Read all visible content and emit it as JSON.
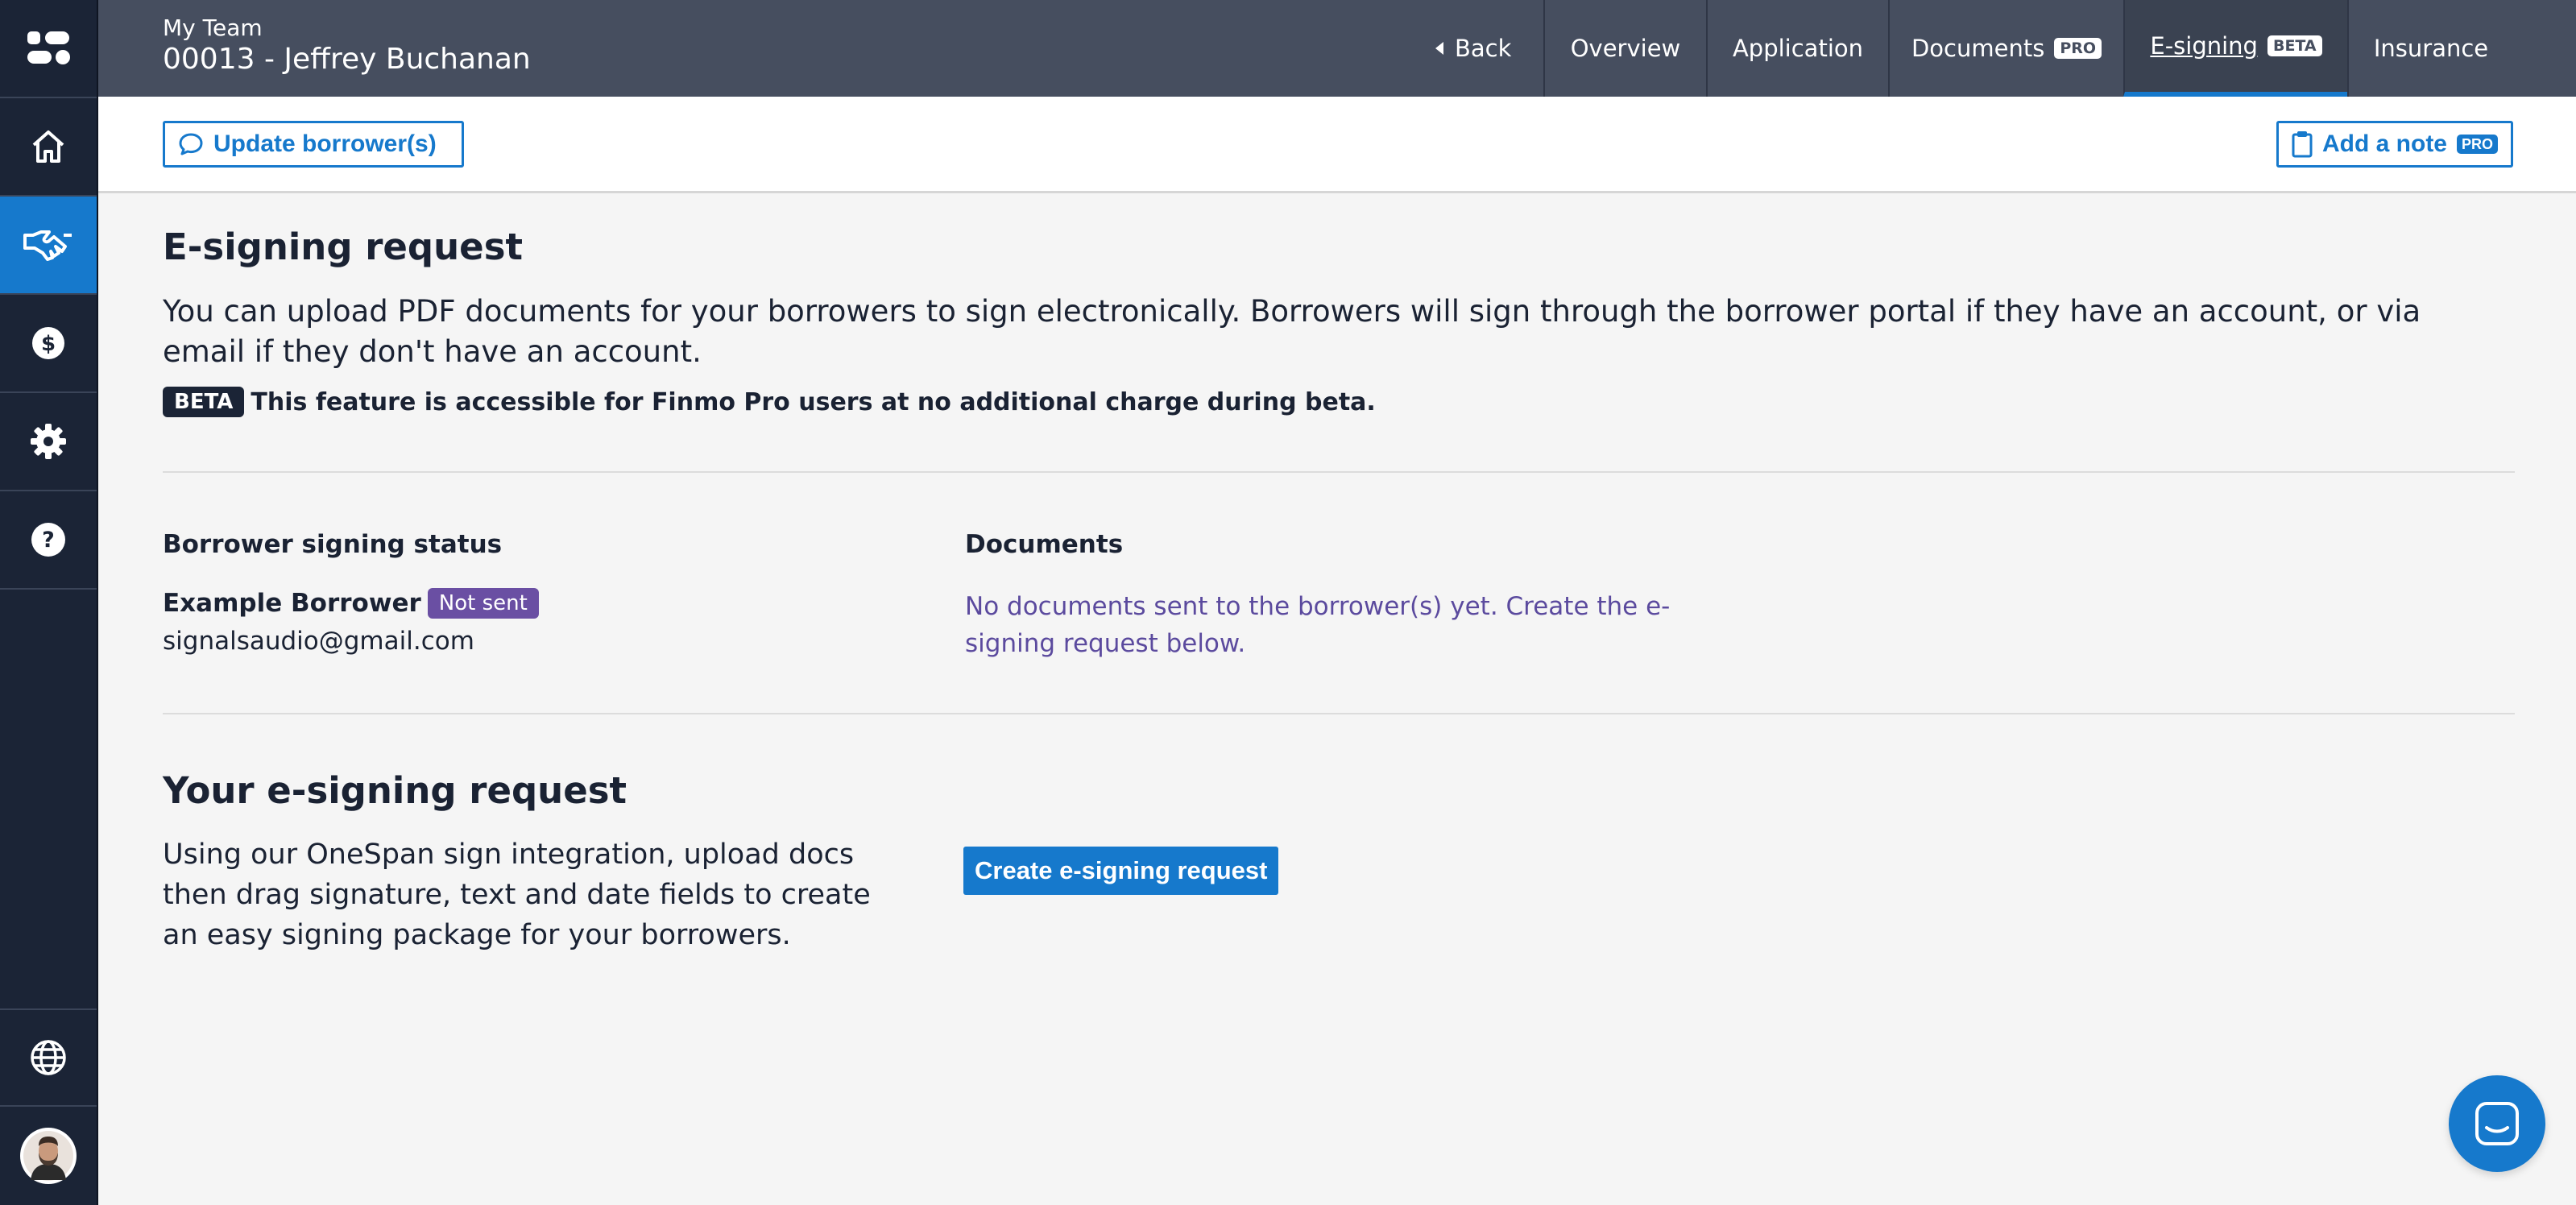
{
  "header": {
    "team_label": "My Team",
    "deal_title": "00013 - Jeffrey Buchanan",
    "back_label": "Back",
    "tabs": [
      {
        "label": "Overview",
        "badge": ""
      },
      {
        "label": "Application",
        "badge": ""
      },
      {
        "label": "Documents",
        "badge": "PRO"
      },
      {
        "label": "E-signing",
        "badge": "BETA"
      },
      {
        "label": "Insurance",
        "badge": ""
      }
    ],
    "active_tab": "E-signing"
  },
  "actionbar": {
    "update_borrowers_label": "Update borrower(s)",
    "add_note_label": "Add a note",
    "add_note_badge": "PRO"
  },
  "esigning": {
    "title": "E-signing request",
    "intro": "You can upload PDF documents for your borrowers to sign electronically. Borrowers will sign through the borrower portal if they have an account, or via email if they don't have an account.",
    "beta_badge": "BETA",
    "beta_note": "This feature is accessible for Finmo Pro users at no additional charge during beta."
  },
  "status_section": {
    "borrower_heading": "Borrower signing status",
    "documents_heading": "Documents",
    "borrower_name": "Example Borrower",
    "borrower_status": "Not sent",
    "borrower_email": "signalsaudio@gmail.com",
    "documents_message": "No documents sent to the borrower(s) yet. Create the e-signing request below."
  },
  "request_section": {
    "title": "Your e-signing request",
    "description": "Using our OneSpan sign integration, upload docs then drag signature, text and date fields to create an easy signing package for your borrowers.",
    "create_button": "Create e-signing request"
  },
  "sidebar": {
    "items": [
      "logo-icon",
      "home-icon",
      "handshake-icon",
      "dollar-icon",
      "gear-icon",
      "help-icon",
      "globe-icon",
      "avatar"
    ],
    "active": "handshake-icon"
  },
  "colors": {
    "sidebar": "#1b2436",
    "topbar": "#464e5f",
    "accent": "#1679cc",
    "status_badge": "#6a4fa3"
  }
}
